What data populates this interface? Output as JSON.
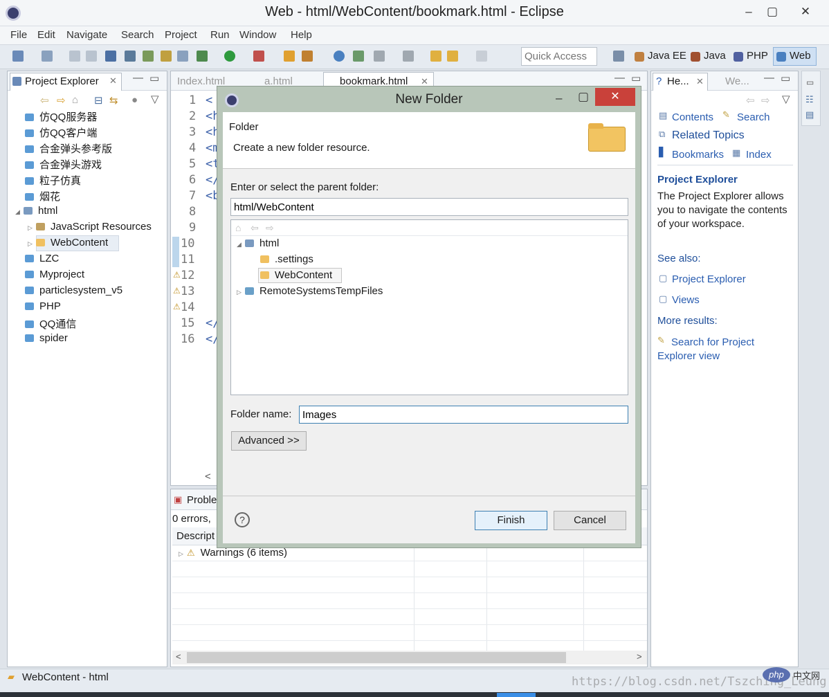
{
  "window": {
    "title": "Web - html/WebContent/bookmark.html - Eclipse"
  },
  "menu": [
    "File",
    "Edit",
    "Navigate",
    "Search",
    "Project",
    "Run",
    "Window",
    "Help"
  ],
  "toolbar": {
    "quick_access_placeholder": "Quick Access"
  },
  "perspectives": [
    "Java EE",
    "Java",
    "PHP",
    "Web"
  ],
  "project_explorer": {
    "title": "Project Explorer",
    "items": [
      {
        "label": "仿QQ服务器",
        "indent": 0
      },
      {
        "label": "仿QQ客户端",
        "indent": 0
      },
      {
        "label": "合金弹头参考版",
        "indent": 0
      },
      {
        "label": "合金弹头游戏",
        "indent": 0
      },
      {
        "label": "粒子仿真",
        "indent": 0
      },
      {
        "label": "烟花",
        "indent": 0
      },
      {
        "label": "html",
        "indent": 0
      },
      {
        "label": "JavaScript Resources",
        "indent": 1
      },
      {
        "label": "WebContent",
        "indent": 1
      },
      {
        "label": "LZC",
        "indent": 0
      },
      {
        "label": "Myproject",
        "indent": 0
      },
      {
        "label": "particlesystem_v5",
        "indent": 0
      },
      {
        "label": "PHP",
        "indent": 0
      },
      {
        "label": "QQ通信",
        "indent": 0
      },
      {
        "label": "spider",
        "indent": 0
      }
    ]
  },
  "editor": {
    "tabs": [
      "Index.html",
      "a.html",
      "bookmark.html"
    ],
    "line_numbers": [
      "1",
      "2",
      "3",
      "4",
      "5",
      "6",
      "7",
      "8",
      "9",
      "10",
      "11",
      "12",
      "13",
      "14",
      "15",
      "16"
    ],
    "code_fragments": [
      "<",
      "<h",
      "<h",
      "<m",
      "<t",
      "</",
      "<b",
      "",
      "",
      "",
      "",
      "",
      "",
      "",
      "</",
      "</"
    ]
  },
  "problems": {
    "tab": "Proble",
    "summary": "0 errors,",
    "col_header": "Descript",
    "row": "Warnings (6 items)"
  },
  "help_view": {
    "tabs": [
      "He...",
      "We..."
    ],
    "links": [
      "Contents",
      "Search",
      "Related Topics",
      "Bookmarks",
      "Index"
    ],
    "heading": "Project Explorer",
    "description": "The Project Explorer allows you to navigate the contents of your workspace.",
    "see_also": "See also:",
    "see_links": [
      "Project Explorer",
      "Views"
    ],
    "more_results": "More results:",
    "search_link": "Search for Project Explorer view"
  },
  "dialog": {
    "title": "New Folder",
    "header_title": "Folder",
    "header_desc": "Create a new folder resource.",
    "parent_label": "Enter or select the parent folder:",
    "parent_value": "html/WebContent",
    "tree": [
      {
        "label": "html",
        "level": 0,
        "expanded": true
      },
      {
        "label": ".settings",
        "level": 1
      },
      {
        "label": "WebContent",
        "level": 1,
        "selected": true
      },
      {
        "label": "RemoteSystemsTempFiles",
        "level": 0,
        "expanded": false
      }
    ],
    "folder_name_label": "Folder name:",
    "folder_name_value": "Images",
    "advanced_label": "Advanced >>",
    "finish_label": "Finish",
    "cancel_label": "Cancel",
    "help_symbol": "?"
  },
  "statusbar": {
    "text": "WebContent - html",
    "watermark": "https://blog.csdn.net/Tszching_Leung",
    "logo_text": "php",
    "logo_caption": "中文网"
  }
}
